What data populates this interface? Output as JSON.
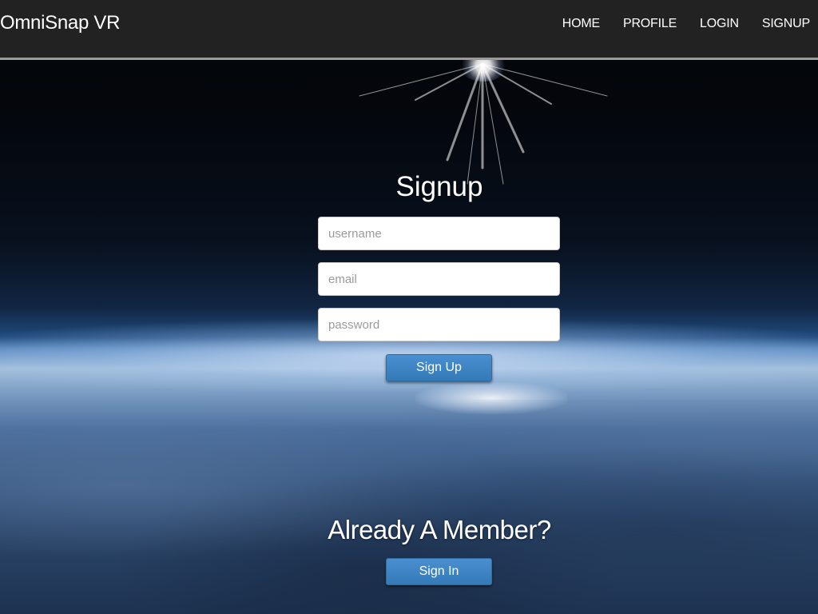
{
  "navbar": {
    "brand": "OmniSnap VR",
    "links": [
      "HOME",
      "PROFILE",
      "LOGIN",
      "SIGNUP"
    ]
  },
  "signup": {
    "title": "Signup",
    "username_placeholder": "username",
    "email_placeholder": "email",
    "password_placeholder": "password",
    "submit_label": "Sign Up"
  },
  "member": {
    "title": "Already A Member?",
    "signin_label": "Sign In"
  },
  "colors": {
    "navbar_bg": "#222222",
    "button_primary": "#337ab7",
    "text": "#ffffff"
  }
}
